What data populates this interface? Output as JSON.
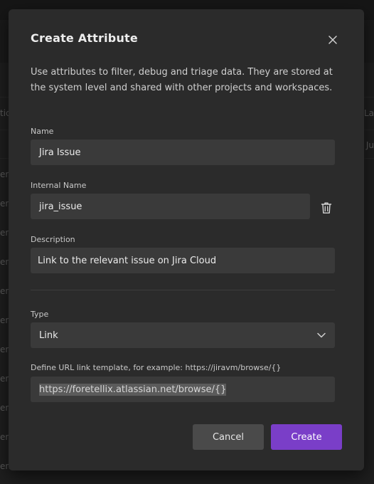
{
  "modal": {
    "title": "Create Attribute",
    "description": "Use attributes to filter, debug and triage data. They are stored at the system level and shared with other projects and workspaces.",
    "fields": {
      "name": {
        "label": "Name",
        "value": "Jira Issue"
      },
      "internal_name": {
        "label": "Internal Name",
        "value": "jira_issue"
      },
      "description": {
        "label": "Description",
        "value": "Link to the relevant issue on Jira Cloud"
      },
      "type": {
        "label": "Type",
        "value": "Link"
      },
      "url_template": {
        "label": "Define URL link template, for example: https://jiravm/browse/{}",
        "value": "https://foretellix.atlassian.net/browse/{}"
      }
    },
    "buttons": {
      "cancel": "Cancel",
      "create": "Create"
    },
    "icons": {
      "close": "close-icon",
      "trash": "trash-icon",
      "chevron": "chevron-down-icon"
    }
  },
  "background": {
    "left_fragments": [
      "tic",
      "en",
      "en",
      "en",
      "en",
      "en",
      "en",
      "en",
      "en",
      "en",
      "en",
      "en"
    ],
    "right_fragments": [
      "La",
      "Ju"
    ]
  },
  "colors": {
    "accent": "#7a3ec8",
    "modal_bg": "#2b2b2b",
    "field_bg": "#3a3a3a"
  }
}
